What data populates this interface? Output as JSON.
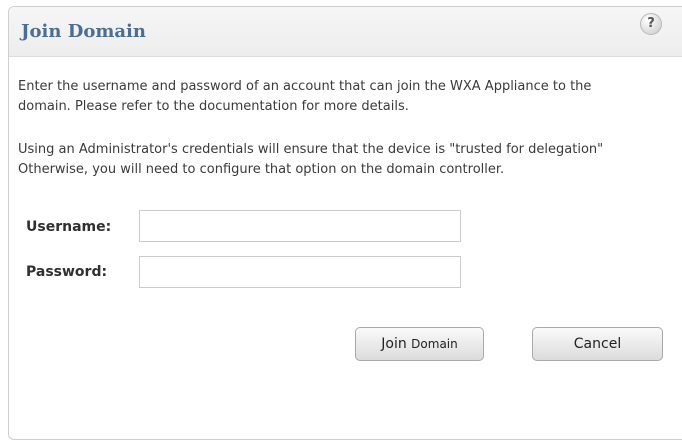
{
  "dialog": {
    "title": "Join Domain",
    "help_label": "?"
  },
  "intro": {
    "line1": "Enter the username and password of an account that can join the WXA Appliance to the",
    "line2": "domain. Please refer to the documentation for more details."
  },
  "note": {
    "line1": "Using an Administrator's credentials will ensure that the device is \"trusted for delegation\"",
    "line2": "Otherwise, you will need to configure that option on the domain controller."
  },
  "form": {
    "username_label": "Username:",
    "username_value": "",
    "password_label": "Password:",
    "password_value": ""
  },
  "buttons": {
    "join_word1": "Join",
    "join_word2": "Domain",
    "cancel_label": "Cancel"
  }
}
